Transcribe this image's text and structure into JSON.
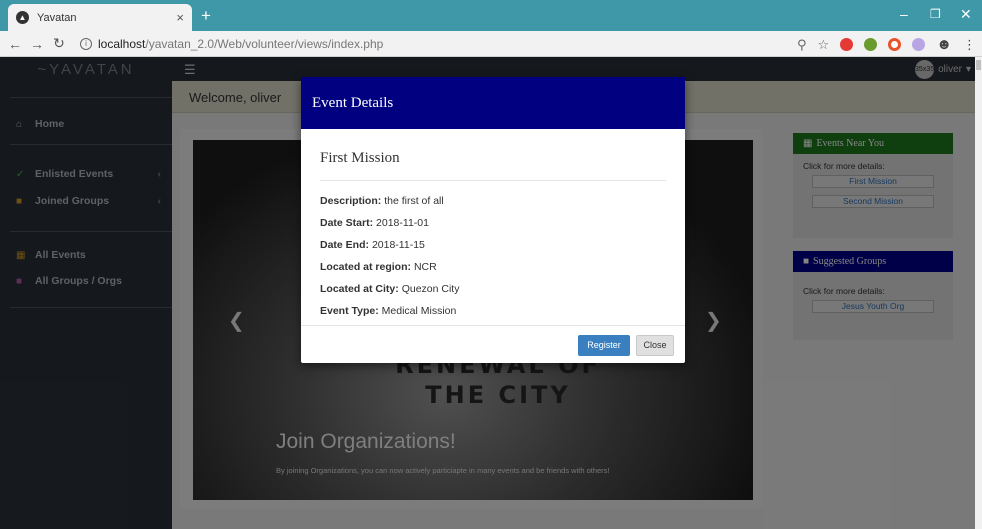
{
  "browser": {
    "tab_title": "Yavatan",
    "url_host": "localhost",
    "url_path": "/yavatan_2.0/Web/volunteer/views/index.php"
  },
  "app": {
    "brand": "~YAVATAN",
    "user_name": "oliver",
    "avatar_label": "35x35",
    "welcome": "Welcome, oliver"
  },
  "sidebar": {
    "items": [
      {
        "label": "Home"
      },
      {
        "label": "Enlisted Events"
      },
      {
        "label": "Joined Groups"
      },
      {
        "label": "All Events"
      },
      {
        "label": "All Groups / Orgs"
      }
    ]
  },
  "carousel": {
    "sign_line1": "RENEWAL OF",
    "sign_line2": "THE CITY",
    "caption": "Join Organizations!",
    "subcaption": "By joining Organizations, you can now actively particiapte in many events and be friends with others!"
  },
  "events_near_you": {
    "title": "Events Near You",
    "hint": "Click for more details:",
    "items": [
      "First Mission",
      "Second Mission"
    ]
  },
  "suggested_groups": {
    "title": "Suggested Groups",
    "hint": "Click for more details:",
    "items": [
      "Jesus Youth Org"
    ]
  },
  "modal": {
    "title": "Event Details",
    "event_name": "First Mission",
    "details": [
      {
        "label": "Description:",
        "value": "the first of all"
      },
      {
        "label": "Date Start:",
        "value": "2018-11-01"
      },
      {
        "label": "Date End:",
        "value": "2018-11-15"
      },
      {
        "label": "Located at region:",
        "value": "NCR"
      },
      {
        "label": "Located at City:",
        "value": "Quezon City"
      },
      {
        "label": "Event Type:",
        "value": "Medical Mission"
      }
    ],
    "register_label": "Register",
    "close_label": "Close"
  },
  "colors": {
    "browser_accent": "#3e98a8",
    "sidebar_bg": "#2a2f38",
    "modal_header": "#000080",
    "events_header": "#1e7a1e",
    "groups_header": "#00008b",
    "register_btn": "#3a80c1"
  }
}
